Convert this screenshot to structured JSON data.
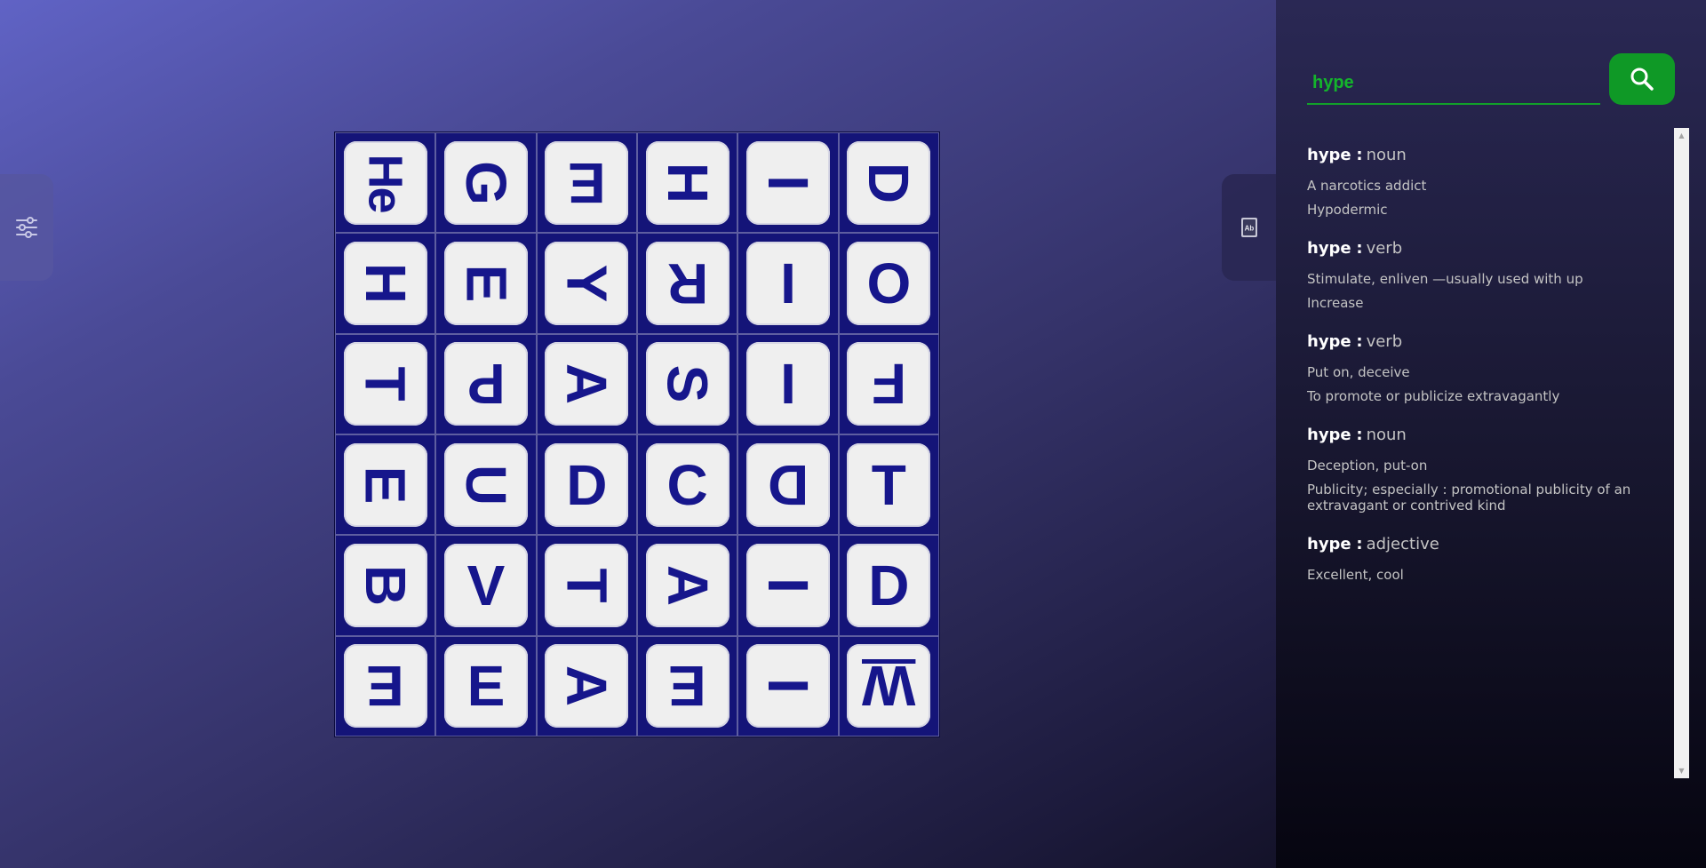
{
  "board": {
    "rows": [
      [
        {
          "letter": "He",
          "rotation": 90,
          "small": true
        },
        {
          "letter": "G",
          "rotation": 90
        },
        {
          "letter": "E",
          "rotation": 180
        },
        {
          "letter": "H",
          "rotation": 90
        },
        {
          "letter": "I",
          "rotation": 90
        },
        {
          "letter": "D",
          "rotation": 90
        }
      ],
      [
        {
          "letter": "H",
          "rotation": 90
        },
        {
          "letter": "E",
          "rotation": 90
        },
        {
          "letter": "Y",
          "rotation": 90
        },
        {
          "letter": "R",
          "rotation": 180
        },
        {
          "letter": "I",
          "rotation": 0
        },
        {
          "letter": "O",
          "rotation": 0
        }
      ],
      [
        {
          "letter": "T",
          "rotation": 90
        },
        {
          "letter": "P",
          "rotation": 180
        },
        {
          "letter": "A",
          "rotation": 90
        },
        {
          "letter": "S",
          "rotation": 90
        },
        {
          "letter": "I",
          "rotation": 0
        },
        {
          "letter": "F",
          "rotation": 180
        }
      ],
      [
        {
          "letter": "E",
          "rotation": 90
        },
        {
          "letter": "U",
          "rotation": 90
        },
        {
          "letter": "D",
          "rotation": 0
        },
        {
          "letter": "C",
          "rotation": 0
        },
        {
          "letter": "D",
          "rotation": 180
        },
        {
          "letter": "T",
          "rotation": 0
        }
      ],
      [
        {
          "letter": "B",
          "rotation": 90
        },
        {
          "letter": "V",
          "rotation": 0
        },
        {
          "letter": "T",
          "rotation": 90
        },
        {
          "letter": "A",
          "rotation": 90
        },
        {
          "letter": "I",
          "rotation": 90
        },
        {
          "letter": "D",
          "rotation": 0
        }
      ],
      [
        {
          "letter": "E",
          "rotation": 180
        },
        {
          "letter": "E",
          "rotation": 0
        },
        {
          "letter": "A",
          "rotation": 90
        },
        {
          "letter": "E",
          "rotation": 180
        },
        {
          "letter": "I",
          "rotation": 90
        },
        {
          "letter": "W",
          "rotation": 180,
          "underline": true
        }
      ]
    ]
  },
  "left_tab": {
    "icon": "sliders-icon"
  },
  "right_tab": {
    "icon": "dictionary-icon",
    "icon_text": "Ab"
  },
  "search": {
    "value": "hype",
    "button_icon": "search-icon"
  },
  "entries": [
    {
      "word": "hype",
      "sep": ":",
      "pos": "noun",
      "defs": [
        "A narcotics addict",
        "Hypodermic"
      ]
    },
    {
      "word": "hype",
      "sep": ":",
      "pos": "verb",
      "defs": [
        "Stimulate, enliven —usually used with up",
        "Increase"
      ]
    },
    {
      "word": "hype",
      "sep": ":",
      "pos": "verb",
      "defs": [
        "Put on, deceive",
        "To promote or publicize extravagantly"
      ]
    },
    {
      "word": "hype",
      "sep": ":",
      "pos": "noun",
      "defs": [
        "Deception, put-on",
        "Publicity; especially : promotional publicity of an extravagant or contrived kind"
      ]
    },
    {
      "word": "hype",
      "sep": ":",
      "pos": "adjective",
      "defs": [
        "Excellent, cool"
      ]
    }
  ],
  "colors": {
    "die_face": "#efefef",
    "letter": "#16168c",
    "board": "#141478",
    "accent_green": "#0f9926"
  }
}
